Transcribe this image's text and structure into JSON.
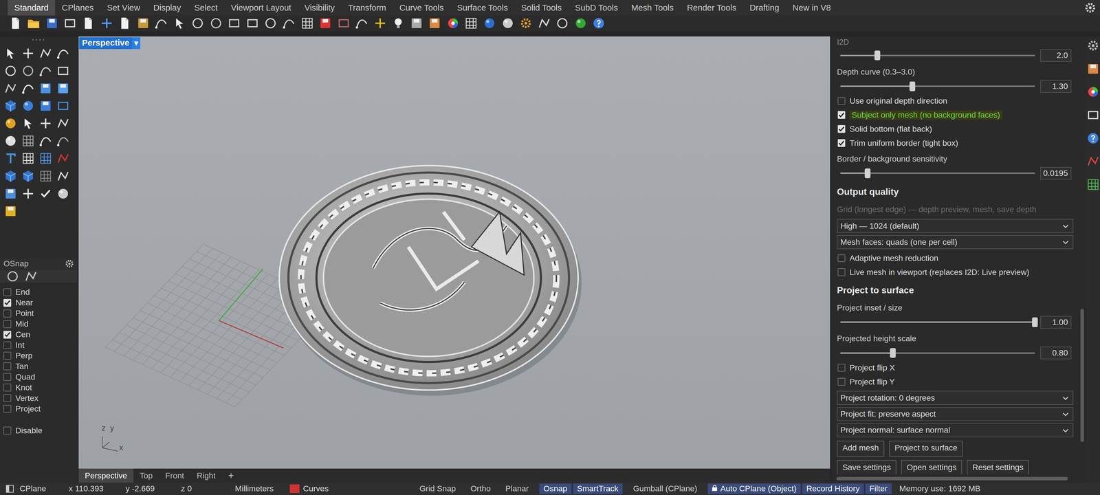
{
  "menu_tabs": [
    {
      "label": "Standard",
      "selected": true
    },
    {
      "label": "CPlanes",
      "selected": false
    },
    {
      "label": "Set View",
      "selected": false
    },
    {
      "label": "Display",
      "selected": false
    },
    {
      "label": "Select",
      "selected": false
    },
    {
      "label": "Viewport Layout",
      "selected": false
    },
    {
      "label": "Visibility",
      "selected": false
    },
    {
      "label": "Transform",
      "selected": false
    },
    {
      "label": "Curve Tools",
      "selected": false
    },
    {
      "label": "Surface Tools",
      "selected": false
    },
    {
      "label": "Solid Tools",
      "selected": false
    },
    {
      "label": "SubD Tools",
      "selected": false
    },
    {
      "label": "Mesh Tools",
      "selected": false
    },
    {
      "label": "Render Tools",
      "selected": false
    },
    {
      "label": "Drafting",
      "selected": false
    },
    {
      "label": "New in V8",
      "selected": false
    }
  ],
  "viewport": {
    "title": "Perspective",
    "menu_arrow": "▾",
    "axis": {
      "z": "z",
      "y": "y",
      "x": "x"
    }
  },
  "viewport_tabs": [
    {
      "label": "Perspective",
      "selected": true
    },
    {
      "label": "Top",
      "selected": false
    },
    {
      "label": "Front",
      "selected": false
    },
    {
      "label": "Right",
      "selected": false
    }
  ],
  "add_viewport": "+",
  "osnap": {
    "title": "OSnap",
    "items": [
      {
        "label": "End",
        "checked": false
      },
      {
        "label": "Near",
        "checked": true
      },
      {
        "label": "Point",
        "checked": false
      },
      {
        "label": "Mid",
        "checked": false
      },
      {
        "label": "Cen",
        "checked": true
      },
      {
        "label": "Int",
        "checked": false
      },
      {
        "label": "Perp",
        "checked": false
      },
      {
        "label": "Tan",
        "checked": false
      },
      {
        "label": "Quad",
        "checked": false
      },
      {
        "label": "Knot",
        "checked": false
      },
      {
        "label": "Vertex",
        "checked": false
      },
      {
        "label": "Project",
        "checked": false
      }
    ],
    "disable": {
      "label": "Disable",
      "checked": false
    }
  },
  "panel": {
    "title": "I2D",
    "controls": [
      {
        "kind": "slider",
        "level": 0.19,
        "value": "2.0"
      },
      {
        "kind": "label",
        "label": "Depth curve (0.3–3.0)"
      },
      {
        "kind": "slider",
        "level": 0.37,
        "value": "1.30"
      },
      {
        "kind": "checkbox",
        "label": "Use original depth direction",
        "checked": false,
        "highlighted": false
      },
      {
        "kind": "checkbox",
        "label": "Subject only mesh (no background faces)",
        "checked": true,
        "highlighted": true
      },
      {
        "kind": "checkbox",
        "label": "Solid bottom (flat back)",
        "checked": true,
        "highlighted": false
      },
      {
        "kind": "checkbox",
        "label": "Trim uniform border (tight box)",
        "checked": true,
        "highlighted": false
      },
      {
        "kind": "label",
        "label": "Border / background sensitivity"
      },
      {
        "kind": "slider",
        "level": 0.14,
        "value": "0.0195"
      },
      {
        "kind": "heading",
        "label": "Output quality"
      },
      {
        "kind": "note",
        "label": "Grid (longest edge) — depth preview, mesh, save depth",
        "disabled": true
      },
      {
        "kind": "dropdown",
        "label": "High — 1024 (default)"
      },
      {
        "kind": "dropdown",
        "label": "Mesh faces: quads (one per cell)"
      },
      {
        "kind": "checkbox",
        "label": "Adaptive mesh reduction",
        "checked": false,
        "highlighted": false
      },
      {
        "kind": "checkbox",
        "label": "Live mesh in viewport (replaces I2D: Live preview)",
        "checked": false,
        "highlighted": false
      },
      {
        "kind": "heading",
        "label": "Project to surface"
      },
      {
        "kind": "label",
        "label": "Project inset / size"
      },
      {
        "kind": "slider",
        "level": 1.0,
        "value": "1.00"
      },
      {
        "kind": "label",
        "label": "Projected height scale"
      },
      {
        "kind": "slider",
        "level": 0.27,
        "value": "0.80"
      },
      {
        "kind": "checkbox",
        "label": "Project flip X",
        "checked": false,
        "highlighted": false
      },
      {
        "kind": "checkbox",
        "label": "Project flip Y",
        "checked": false,
        "highlighted": false
      },
      {
        "kind": "dropdown",
        "label": "Project rotation: 0 degrees"
      },
      {
        "kind": "dropdown",
        "label": "Project fit: preserve aspect"
      },
      {
        "kind": "dropdown",
        "label": "Project normal: surface normal"
      },
      {
        "kind": "buttons",
        "buttons": [
          "Add mesh",
          "Project to surface"
        ]
      },
      {
        "kind": "buttons",
        "buttons": [
          "Save settings",
          "Open settings",
          "Reset settings"
        ]
      }
    ]
  },
  "status_bar": {
    "cplane": "CPlane",
    "x": "x 110.393",
    "y": "y -2.669",
    "z": "z 0",
    "units": "Millimeters",
    "layer": {
      "label": "Curves",
      "color": "#cc3333"
    },
    "toggles": [
      {
        "label": "Grid Snap",
        "on": false
      },
      {
        "label": "Ortho",
        "on": false
      },
      {
        "label": "Planar",
        "on": false
      },
      {
        "label": "Osnap",
        "on": true
      },
      {
        "label": "SmartTrack",
        "on": true
      },
      {
        "label": "Gumball (CPlane)",
        "on": false
      },
      {
        "label": "Auto CPlane (Object)",
        "on": true
      },
      {
        "label": "Record History",
        "on": true
      },
      {
        "label": "Filter",
        "on": true
      }
    ],
    "memory": "Memory use: 1692 MB"
  }
}
